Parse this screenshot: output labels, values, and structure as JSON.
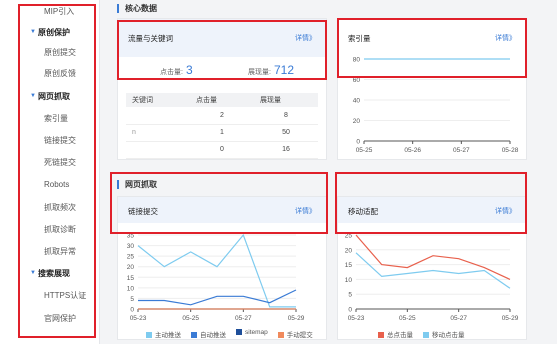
{
  "sidebar": {
    "items": [
      {
        "label": "MIP引入",
        "type": "sub"
      },
      {
        "label": "原创保护",
        "type": "group"
      },
      {
        "label": "原创提交",
        "type": "sub"
      },
      {
        "label": "原创反馈",
        "type": "sub"
      },
      {
        "label": "网页抓取",
        "type": "group"
      },
      {
        "label": "索引量",
        "type": "sub"
      },
      {
        "label": "链接提交",
        "type": "sub"
      },
      {
        "label": "死链提交",
        "type": "sub"
      },
      {
        "label": "Robots",
        "type": "sub"
      },
      {
        "label": "抓取频次",
        "type": "sub"
      },
      {
        "label": "抓取诊断",
        "type": "sub"
      },
      {
        "label": "抓取异常",
        "type": "sub"
      },
      {
        "label": "搜索展现",
        "type": "group"
      },
      {
        "label": "HTTPS认证",
        "type": "sub"
      },
      {
        "label": "官网保护",
        "type": "sub"
      }
    ]
  },
  "core_section_title": "核心数据",
  "crawl_section_title": "网页抓取",
  "traffic_card": {
    "title": "流量与关键词",
    "more": "详情》",
    "clicks_label": "点击量:",
    "clicks_value": "3",
    "impressions_label": "展现量:",
    "impressions_value": "712",
    "table": {
      "headers": [
        "关键词",
        "点击量",
        "展现量"
      ],
      "rows": [
        [
          "",
          "2",
          "8"
        ],
        [
          "n",
          "1",
          "50"
        ],
        [
          "",
          "0",
          "16"
        ]
      ]
    }
  },
  "index_card": {
    "title": "索引量",
    "more": "详情》"
  },
  "link_card": {
    "title": "链接提交",
    "more": "详情》"
  },
  "mobile_card": {
    "title": "移动适配",
    "more": "详情》"
  },
  "colors": {
    "accent": "#3a7bd5",
    "highlight_box": "#e0202a"
  },
  "chart_data": [
    {
      "type": "line",
      "name": "index",
      "x": [
        "05-25",
        "05-26",
        "05-27",
        "05-28"
      ],
      "series": [
        {
          "name": "",
          "values": [
            80,
            80,
            80,
            80
          ],
          "color": "#7ecbef"
        }
      ],
      "ylim": [
        0,
        80
      ],
      "yticks": [
        0,
        20,
        40,
        60,
        80
      ]
    },
    {
      "type": "line",
      "name": "link",
      "x": [
        "05-23",
        "05-25",
        "05-27",
        "05-29"
      ],
      "x_points": [
        "05-23",
        "05-24",
        "05-25",
        "05-26",
        "05-27",
        "05-28",
        "05-29"
      ],
      "series": [
        {
          "name": "主动推送",
          "values": [
            30,
            20,
            27,
            20,
            35,
            1,
            1
          ],
          "color": "#7ecbef"
        },
        {
          "name": "自动推送",
          "values": [
            4,
            4,
            2,
            6,
            6,
            3,
            9
          ],
          "color": "#3a7bd5"
        },
        {
          "name": "sitemap",
          "values": [
            0,
            0,
            0,
            0,
            0,
            0,
            0
          ],
          "color": "#1f4f9a"
        },
        {
          "name": "手动提交",
          "values": [
            0,
            0,
            0,
            0,
            0,
            0,
            0
          ],
          "color": "#f08a5d"
        }
      ],
      "ylim": [
        0,
        35
      ],
      "yticks": [
        0,
        5,
        10,
        15,
        20,
        25,
        30,
        35
      ]
    },
    {
      "type": "line",
      "name": "mobile",
      "x": [
        "05-23",
        "05-25",
        "05-27",
        "05-29"
      ],
      "x_points": [
        "05-23",
        "05-24",
        "05-25",
        "05-26",
        "05-27",
        "05-28",
        "05-29"
      ],
      "series": [
        {
          "name": "总点击量",
          "values": [
            25,
            15,
            14,
            18,
            17,
            14,
            10
          ],
          "color": "#e8604c"
        },
        {
          "name": "移动点击量",
          "values": [
            19,
            11,
            12,
            13,
            12,
            13,
            7
          ],
          "color": "#7ecbef"
        }
      ],
      "ylim": [
        0,
        25
      ],
      "yticks": [
        0,
        5,
        10,
        15,
        20,
        25
      ]
    }
  ]
}
